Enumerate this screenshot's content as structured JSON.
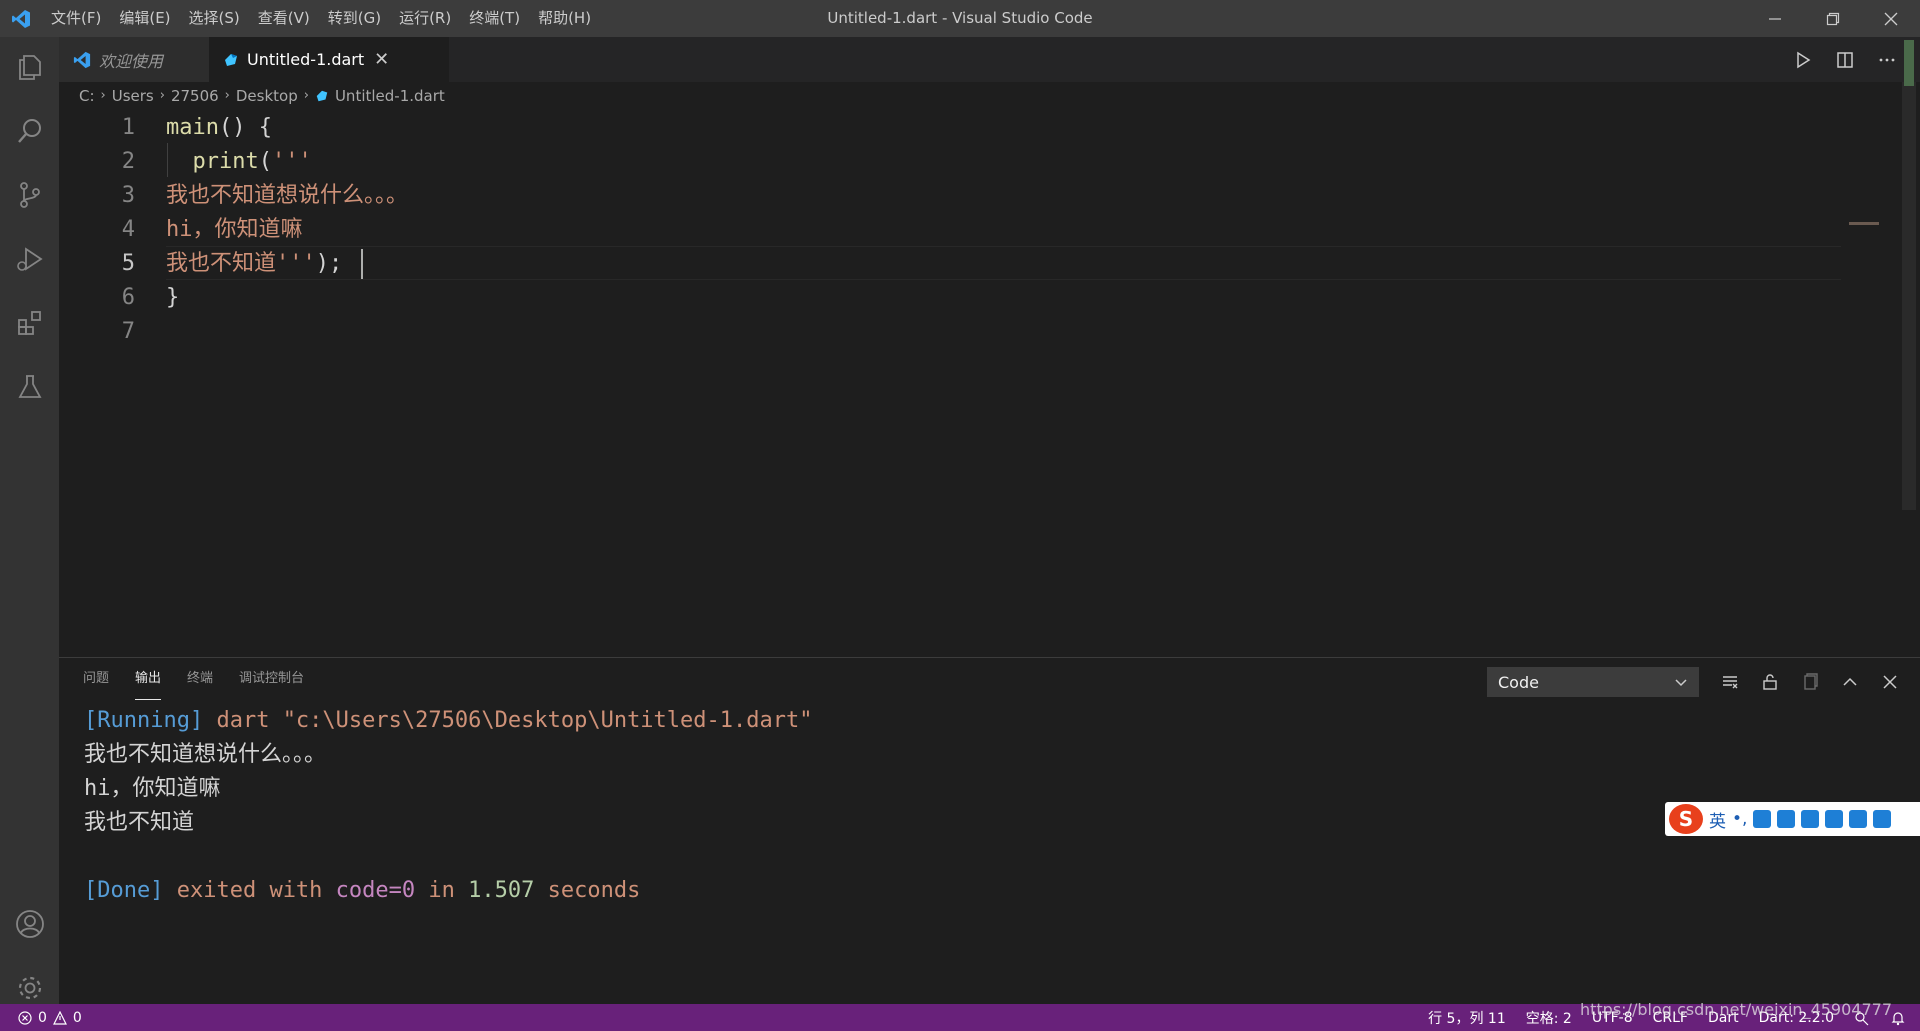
{
  "titlebar": {
    "window_title": "Untitled-1.dart - Visual Studio Code",
    "menu": [
      "文件(F)",
      "编辑(E)",
      "选择(S)",
      "查看(V)",
      "转到(G)",
      "运行(R)",
      "终端(T)",
      "帮助(H)"
    ]
  },
  "activity_bar": [
    "files-icon",
    "search-icon",
    "source-control-icon",
    "run-debug-icon",
    "extensions-icon",
    "testing-icon",
    "account-icon",
    "gear-icon"
  ],
  "tabs": [
    {
      "label": "欢迎使用",
      "active": false
    },
    {
      "label": "Untitled-1.dart",
      "active": true
    }
  ],
  "breadcrumbs": [
    "C:",
    "Users",
    "27506",
    "Desktop",
    "Untitled-1.dart"
  ],
  "editor": {
    "line_numbers": [
      "1",
      "2",
      "3",
      "4",
      "5",
      "6",
      "7"
    ],
    "lines": [
      {
        "fn": "main",
        "rest": "() {"
      },
      {
        "indent": "  ",
        "fn": "print",
        "rest": "(",
        "str": "'''"
      },
      {
        "str": "我也不知道想说什么。。。"
      },
      {
        "str": "hi，你知道嘛"
      },
      {
        "str": "我也不知道'''",
        "rest": ");"
      },
      {
        "rest": "}"
      },
      {
        "rest": ""
      }
    ],
    "cursor": {
      "line": 5,
      "column": 11
    }
  },
  "panel": {
    "tabs": [
      "问题",
      "输出",
      "终端",
      "调试控制台"
    ],
    "active_tab": "输出",
    "channel": "Code",
    "output": {
      "running_tag": "[Running]",
      "running_cmd": " dart \"c:\\Users\\27506\\Desktop\\Untitled-1.dart\"",
      "lines": [
        "我也不知道想说什么。。。",
        "hi，你知道嘛",
        "我也不知道"
      ],
      "done_tag": "[Done]",
      "done_text_1": " exited with ",
      "done_code": "code=0",
      "done_text_2": " in ",
      "done_seconds": "1.507",
      "done_text_3": " seconds"
    }
  },
  "ime": {
    "mode": "英",
    "punct": "•,"
  },
  "statusbar": {
    "errors": "0",
    "warnings": "0",
    "position": "行 5，列 11",
    "spaces": "空格: 2",
    "encoding": "UTF-8",
    "eol": "CRLF",
    "language": "Dart",
    "sdk": "Dart: 2.2.0",
    "watermark": "https://blog.csdn.net/weixin_45904777"
  },
  "colors": {
    "statusbar": "#68217a",
    "editor_bg": "#1e1e1e",
    "string": "#ce9178",
    "function": "#dcdcaa",
    "keyword_blue": "#569cd6"
  }
}
